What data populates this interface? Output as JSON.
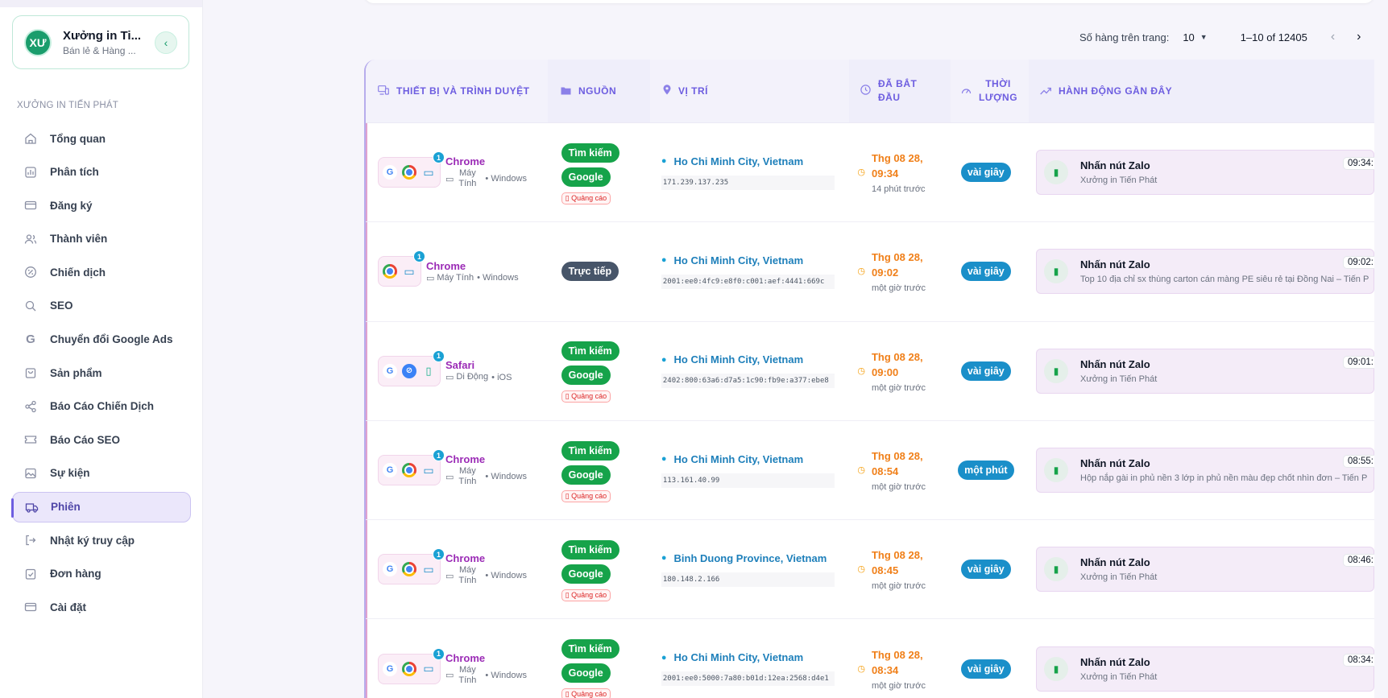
{
  "sidebar": {
    "workspace": {
      "initials": "XƯ",
      "name": "Xưởng in Ti...",
      "subtitle": "Bán lẻ & Hàng ..."
    },
    "section_label": "XƯỞNG IN TIẾN PHÁT",
    "items": [
      {
        "label": "Tổng quan",
        "icon": "home-icon"
      },
      {
        "label": "Phân tích",
        "icon": "chart-icon"
      },
      {
        "label": "Đăng ký",
        "icon": "card-icon"
      },
      {
        "label": "Thành viên",
        "icon": "users-icon"
      },
      {
        "label": "Chiến dịch",
        "icon": "percent-icon"
      },
      {
        "label": "SEO",
        "icon": "search-icon"
      },
      {
        "label": "Chuyển đổi Google Ads",
        "icon": "google-icon"
      },
      {
        "label": "Sản phẩm",
        "icon": "bag-icon"
      },
      {
        "label": "Báo Cáo Chiến Dịch",
        "icon": "share-icon"
      },
      {
        "label": "Báo Cáo SEO",
        "icon": "ticket-icon"
      },
      {
        "label": "Sự kiện",
        "icon": "image-icon"
      },
      {
        "label": "Phiên",
        "icon": "truck-icon",
        "active": true
      },
      {
        "label": "Nhật ký truy cập",
        "icon": "logout-icon"
      },
      {
        "label": "Đơn hàng",
        "icon": "clipboard-icon"
      },
      {
        "label": "Cài đặt",
        "icon": "card-icon"
      }
    ]
  },
  "pager": {
    "rows_label": "Số hàng trên trang:",
    "rows_value": "10",
    "range": "1–10 of 12405"
  },
  "table": {
    "headers": {
      "device": "THIẾT BỊ VÀ TRÌNH DUYỆT",
      "source": "NGUỒN",
      "location": "VỊ TRÍ",
      "started_l1": "ĐÃ BẮT",
      "started_l2": "ĐẦU",
      "duration_l1": "THỜI",
      "duration_l2": "LƯỢNG",
      "recent": "HÀNH ĐỘNG GẦN ĐÂY"
    },
    "rows": [
      {
        "browser": "Chrome",
        "device_type": "Máy Tính",
        "os": "Windows",
        "badge": "1",
        "sources": [
          "Tìm kiếm",
          "Google"
        ],
        "ad": "Quảng cáo",
        "location": "Ho Chi Minh City, Vietnam",
        "ip": "171.239.137.235",
        "time1": "Thg 08 28,",
        "time2": "09:34",
        "ago": "14 phút trước",
        "duration": "vài giây",
        "action": "Nhấn nút Zalo",
        "action_sub": "Xưởng in Tiến Phát",
        "action_time": "09:34:"
      },
      {
        "browser": "Chrome",
        "device_type": "Máy Tính",
        "os": "Windows",
        "badge": "1",
        "sources": [
          "Trực tiếp"
        ],
        "ad": "",
        "location": "Ho Chi Minh City, Vietnam",
        "ip": "2001:ee0:4fc9:e8f0:c001:aef:4441:669c",
        "time1": "Thg 08 28,",
        "time2": "09:02",
        "ago": "một giờ trước",
        "duration": "vài giây",
        "action": "Nhấn nút Zalo",
        "action_sub": "Top 10 địa chỉ sx thùng carton cán màng PE siêu rẻ tại Đồng Nai – Tiến P",
        "action_time": "09:02:"
      },
      {
        "browser": "Safari",
        "device_type": "Di Động",
        "os": "iOS",
        "badge": "1",
        "sources": [
          "Tìm kiếm",
          "Google"
        ],
        "ad": "Quảng cáo",
        "location": "Ho Chi Minh City, Vietnam",
        "ip": "2402:800:63a6:d7a5:1c90:fb9e:a377:ebe8",
        "time1": "Thg 08 28,",
        "time2": "09:00",
        "ago": "một giờ trước",
        "duration": "vài giây",
        "action": "Nhấn nút Zalo",
        "action_sub": "Xưởng in Tiến Phát",
        "action_time": "09:01:"
      },
      {
        "browser": "Chrome",
        "device_type": "Máy Tính",
        "os": "Windows",
        "badge": "1",
        "sources": [
          "Tìm kiếm",
          "Google"
        ],
        "ad": "Quảng cáo",
        "location": "Ho Chi Minh City, Vietnam",
        "ip": "113.161.40.99",
        "time1": "Thg 08 28,",
        "time2": "08:54",
        "ago": "một giờ trước",
        "duration": "một phút",
        "action": "Nhấn nút Zalo",
        "action_sub": "Hộp nắp gài in phủ nền 3 lớp in phủ nền màu đẹp chốt nhìn đơn – Tiến P",
        "action_time": "08:55:"
      },
      {
        "browser": "Chrome",
        "device_type": "Máy Tính",
        "os": "Windows",
        "badge": "1",
        "sources": [
          "Tìm kiếm",
          "Google"
        ],
        "ad": "Quảng cáo",
        "location": "Binh Duong Province, Vietnam",
        "ip": "180.148.2.166",
        "time1": "Thg 08 28,",
        "time2": "08:45",
        "ago": "một giờ trước",
        "duration": "vài giây",
        "action": "Nhấn nút Zalo",
        "action_sub": "Xưởng in Tiến Phát",
        "action_time": "08:46:"
      },
      {
        "browser": "Chrome",
        "device_type": "Máy Tính",
        "os": "Windows",
        "badge": "1",
        "sources": [
          "Tìm kiếm",
          "Google"
        ],
        "ad": "Quảng cáo",
        "location": "Ho Chi Minh City, Vietnam",
        "ip": "2001:ee0:5000:7a80:b01d:12ea:2568:d4e1",
        "time1": "Thg 08 28,",
        "time2": "08:34",
        "ago": "một giờ trước",
        "duration": "vài giây",
        "action": "Nhấn nút Zalo",
        "action_sub": "Xưởng in Tiến Phát",
        "action_time": "08:34:"
      }
    ]
  }
}
